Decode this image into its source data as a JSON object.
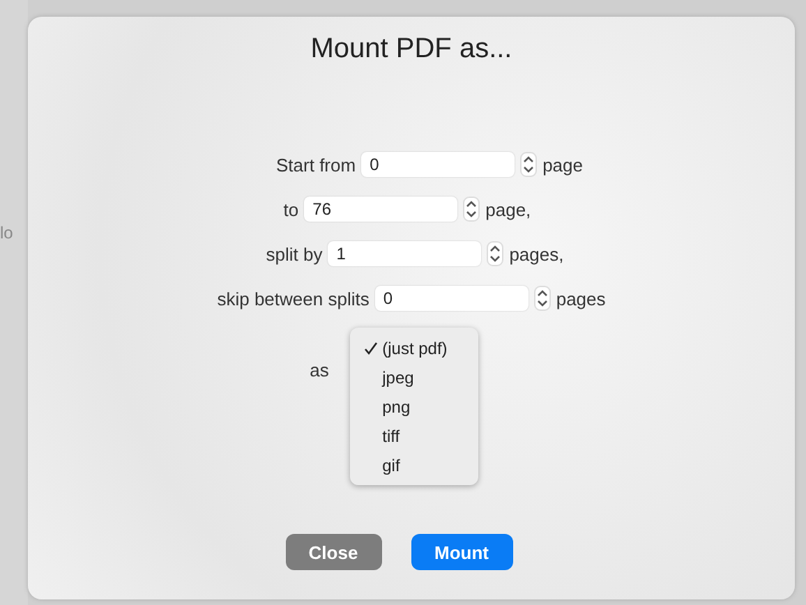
{
  "background": {
    "text": "lo"
  },
  "dialog": {
    "title": "Mount PDF as...",
    "fields": [
      {
        "label": "Start from",
        "value": "0",
        "unit": "page"
      },
      {
        "label": "to",
        "value": "76",
        "unit": "page,"
      },
      {
        "label": "split by",
        "value": "1",
        "unit": "pages,"
      },
      {
        "label": "skip between splits",
        "value": "0",
        "unit": "pages"
      }
    ],
    "format_label": "as",
    "format_menu": [
      {
        "label": "(just pdf)",
        "selected": true
      },
      {
        "label": "jpeg",
        "selected": false
      },
      {
        "label": "png",
        "selected": false
      },
      {
        "label": "tiff",
        "selected": false
      },
      {
        "label": "gif",
        "selected": false
      }
    ],
    "buttons": [
      {
        "label": "Close",
        "kind": "secondary"
      },
      {
        "label": "Mount",
        "kind": "primary"
      }
    ]
  }
}
